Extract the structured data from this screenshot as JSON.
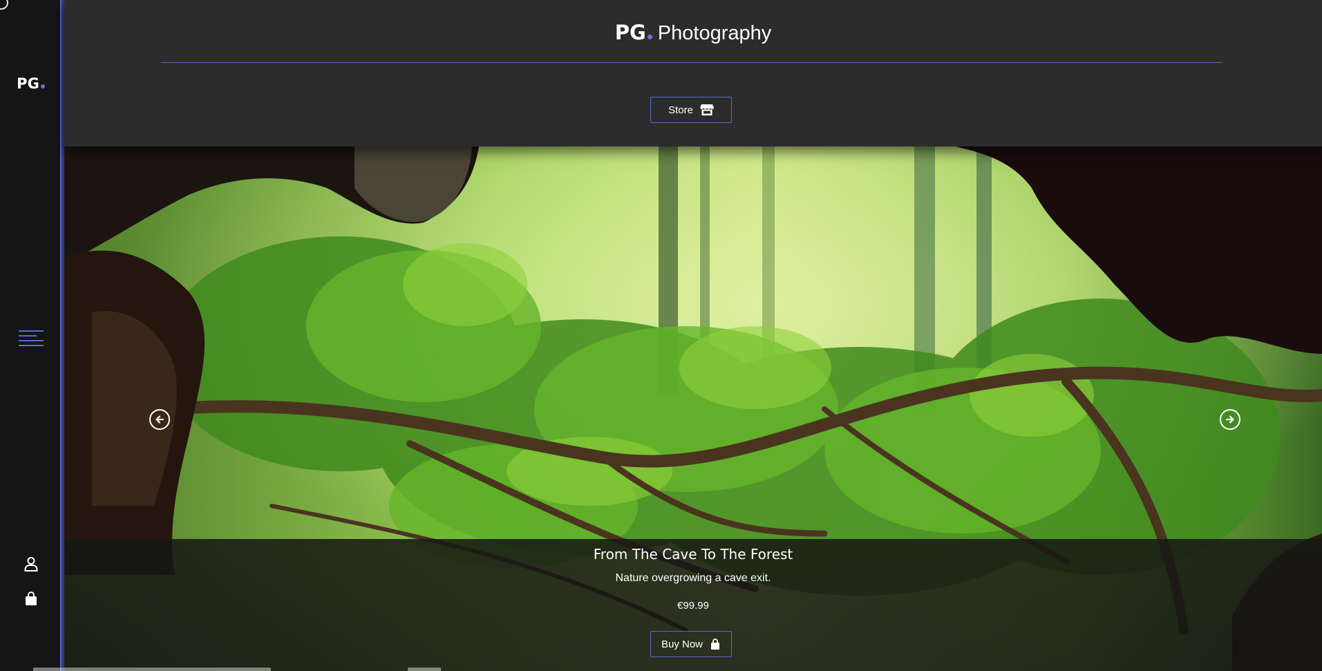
{
  "sidebar": {
    "logo": "PG",
    "accent": "#6b73d8",
    "icons": [
      "menu-icon",
      "user-icon",
      "shopping-bag-icon"
    ]
  },
  "header": {
    "logo_mark": "PG",
    "site_name": "Photography",
    "store_label": "Store",
    "store_icon": "store-icon"
  },
  "hero": {
    "title": "From The Cave To The Forest",
    "description": "Nature overgrowing a cave exit.",
    "price": "€99.99",
    "buy_label": "Buy Now",
    "buy_icon": "shopping-bag-icon",
    "prev_icon": "arrow-left-circle-icon",
    "next_icon": "arrow-right-circle-icon"
  },
  "colors": {
    "sidebar_bg": "#151515",
    "header_bg": "#2c2c2c",
    "accent": "#5a6ad6"
  }
}
